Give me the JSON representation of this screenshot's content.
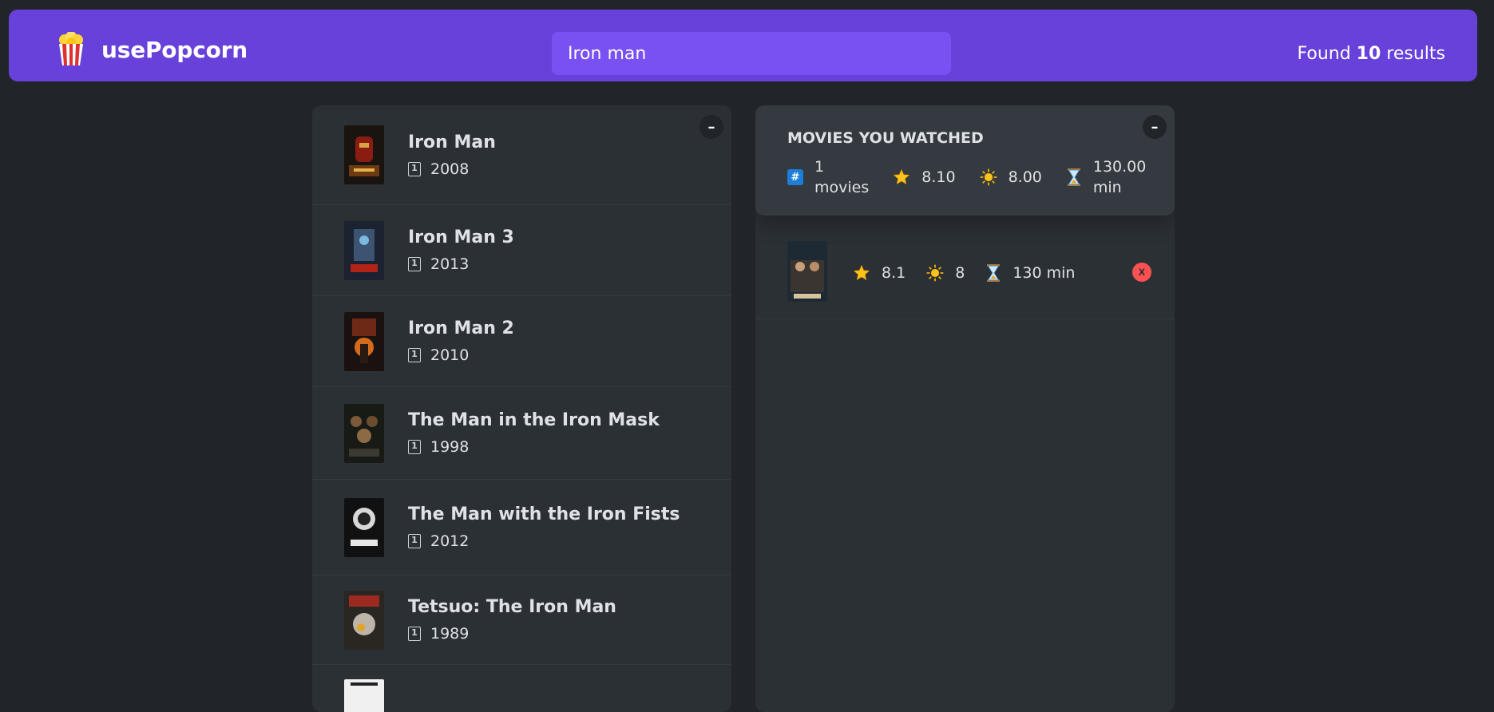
{
  "header": {
    "logo_text": "usePopcorn",
    "search": {
      "value": "Iron man",
      "placeholder": "Search movies..."
    },
    "results_prefix": "Found ",
    "results_count": "10",
    "results_suffix": " results"
  },
  "search_list": {
    "toggle_label": "–",
    "movies": [
      {
        "title": "Iron Man",
        "year": "2008"
      },
      {
        "title": "Iron Man 3",
        "year": "2013"
      },
      {
        "title": "Iron Man 2",
        "year": "2010"
      },
      {
        "title": "The Man in the Iron Mask",
        "year": "1998"
      },
      {
        "title": "The Man with the Iron Fists",
        "year": "2012"
      },
      {
        "title": "Tetsuo: The Iron Man",
        "year": "1989"
      }
    ]
  },
  "watched": {
    "toggle_label": "–",
    "summary_title": "MOVIES YOU WATCHED",
    "count_line1": "1",
    "count_line2": "movies",
    "imdb_avg": "8.10",
    "user_avg": "8.00",
    "runtime_line1": "130.00",
    "runtime_line2": "min",
    "items": [
      {
        "imdb": "8.1",
        "user": "8",
        "runtime": "130 min",
        "delete_label": "X"
      }
    ]
  },
  "colors": {
    "primary": "#6741d9",
    "primary_light": "#7950f2",
    "background": "#212529",
    "box": "#2b3035",
    "red": "#fa5252"
  }
}
